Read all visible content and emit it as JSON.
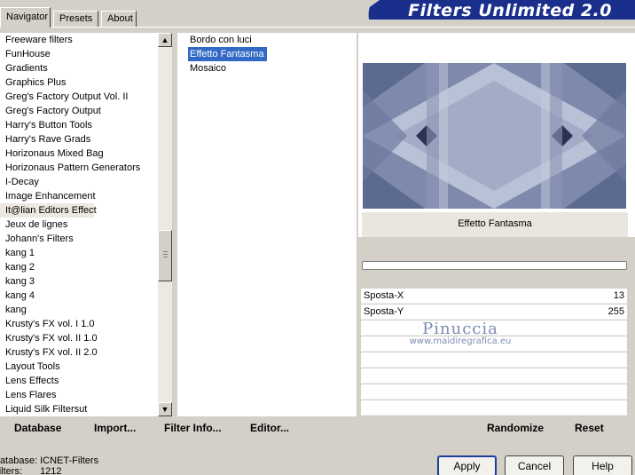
{
  "tabs": [
    "Navigator",
    "Presets",
    "About"
  ],
  "banner": "Filters Unlimited 2.0",
  "categories": [
    "Freeware filters",
    "FunHouse",
    "Gradients",
    "Graphics Plus",
    "Greg's Factory Output Vol. II",
    "Greg's Factory Output",
    "Harry's Button Tools",
    "Harry's Rave Grads",
    "Horizonaus Mixed Bag",
    "Horizonaus Pattern Generators",
    "I-Decay",
    "Image Enhancement",
    "It@lian Editors Effect",
    "Jeux de lignes",
    "Johann's Filters",
    "kang 1",
    "kang 2",
    "kang 3",
    "kang 4",
    "kang",
    "Krusty's FX vol. I 1.0",
    "Krusty's FX vol. II 1.0",
    "Krusty's FX vol. II 2.0",
    "Layout Tools",
    "Lens Effects",
    "Lens Flares",
    "Liquid Silk Filtersut"
  ],
  "highlighted_category": "It@lian Editors Effect",
  "filters": [
    "Bordo con luci",
    "Effetto Fantasma",
    "Mosaico"
  ],
  "selected_filter": "Effetto Fantasma",
  "filter_name": "Effetto Fantasma",
  "params": [
    {
      "label": "Sposta-X",
      "value": "13"
    },
    {
      "label": "Sposta-Y",
      "value": "255"
    }
  ],
  "watermark": {
    "line1": "Pinuccia",
    "line2": "www.maidiregrafica.eu"
  },
  "bottom_links": {
    "database": "Database",
    "import": "Import...",
    "filter_info": "Filter Info...",
    "editor": "Editor...",
    "randomize": "Randomize",
    "reset": "Reset"
  },
  "status": {
    "database_label": "Database:",
    "database_value": "ICNET-Filters",
    "filters_label": "Filters:",
    "filters_value": "1212"
  },
  "buttons": {
    "apply": "Apply",
    "cancel": "Cancel",
    "help": "Help"
  },
  "colors": {
    "selection": "#316ac5",
    "banner": "#1a2f8c",
    "preview": "#7e8aac"
  }
}
